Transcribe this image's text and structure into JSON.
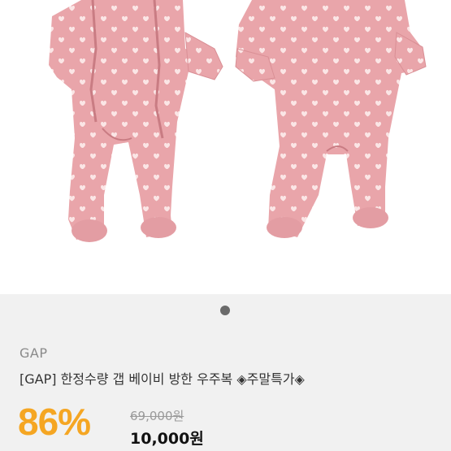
{
  "product": {
    "image_alt": "Pink heart-print baby snowsuit, back and side views",
    "colors": {
      "garment": "#e8a6aa",
      "hearts": "#fbe6e6",
      "accent": "#f5a623"
    },
    "carousel_active_index": 1,
    "carousel_count": 1,
    "brand": "GAP",
    "title": "[GAP] 한정수량 갭 베이비 방한 우주복 ◈주말특가◈",
    "discount": "86%",
    "original_price": "69,000원",
    "sale_price": "10,000원"
  }
}
